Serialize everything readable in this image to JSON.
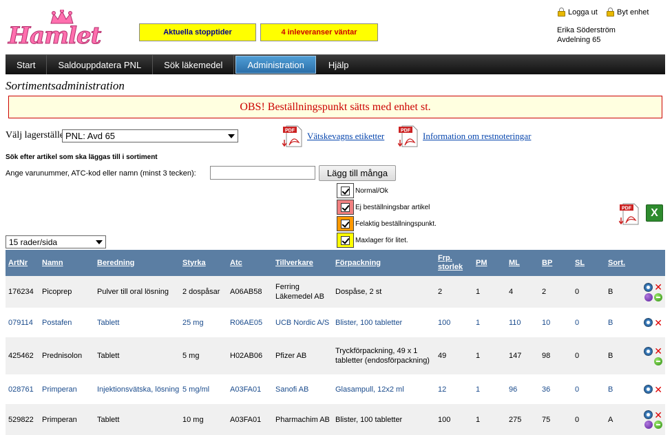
{
  "brand": {
    "logo_text": "Hamlet",
    "logo_color": "#ff6fae"
  },
  "notices": {
    "stopptider": "Aktuella stopptider",
    "inleveranser": "4 inleveranser väntar"
  },
  "top_links": {
    "logout": "Logga ut",
    "switch_unit": "Byt enhet"
  },
  "user": {
    "name": "Erika Söderström",
    "unit": "Avdelning 65"
  },
  "nav": {
    "tabs": [
      "Start",
      "Saldouppdatera PNL",
      "Sök läkemedel",
      "Administration",
      "Hjälp"
    ],
    "active": "Administration"
  },
  "page": {
    "title": "Sortimentsadministration"
  },
  "alert": {
    "text": "OBS! Beställningspunkt sätts med enhet st."
  },
  "stock_select": {
    "label": "Välj lagerställe",
    "value": "PNL: Avd 65"
  },
  "pdf_links": {
    "vatskevagn": "Vätskevagns etiketter",
    "restnoteringar": "Information om restnoteringar",
    "icon_label": "PDF"
  },
  "search": {
    "heading": "Sök efter artikel som ska läggas till i sortiment",
    "label": "Ange varunummer, ATC-kod eller namn (minst 3 tecken):",
    "value": "",
    "button": "Lägg till många"
  },
  "legend": [
    {
      "label": "Normal/Ok",
      "color": "#ffffff"
    },
    {
      "label": "Ej beställningsbar artikel",
      "color": "#f08080"
    },
    {
      "label": "Felaktig beställningspunkt.",
      "color": "#ff9900"
    },
    {
      "label": "Maxlager för litet.",
      "color": "#ffff00"
    }
  ],
  "rows_per_page": {
    "value": "15 rader/sida"
  },
  "excel_icon": "X",
  "table": {
    "columns": [
      "ArtNr",
      "Namn",
      "Beredning",
      "Styrka",
      "Atc",
      "Tillverkare",
      "Förpackning",
      "Frp. storlek",
      "PM",
      "ML",
      "BP",
      "SL",
      "Sort."
    ],
    "rows": [
      {
        "artnr": "176234",
        "namn": "Picoprep",
        "beredning": "Pulver till oral lösning",
        "styrka": "2 dospåsar",
        "atc": "A06AB58",
        "tillverkare": "Ferring Läkemedel AB",
        "forpackning": "Dospåse, 2 st",
        "frp": "2",
        "pm": "1",
        "ml": "4",
        "bp": "2",
        "sl": "0",
        "sort": "B",
        "style": "dark",
        "extra": true
      },
      {
        "artnr": "079114",
        "namn": "Postafen",
        "beredning": "Tablett",
        "styrka": "25 mg",
        "atc": "R06AE05",
        "tillverkare": "UCB Nordic A/S",
        "forpackning": "Blister, 100 tabletter",
        "frp": "100",
        "pm": "1",
        "ml": "110",
        "bp": "10",
        "sl": "0",
        "sort": "B",
        "style": "link",
        "extra": false
      },
      {
        "artnr": "425462",
        "namn": "Prednisolon",
        "beredning": "Tablett",
        "styrka": "5 mg",
        "atc": "H02AB06",
        "tillverkare": "Pfizer AB",
        "forpackning": "Tryckförpackning, 49 x 1 tabletter (endosförpackning)",
        "frp": "49",
        "pm": "1",
        "ml": "147",
        "bp": "98",
        "sl": "0",
        "sort": "B",
        "style": "dark",
        "extra": "green"
      },
      {
        "artnr": "028761",
        "namn": "Primperan",
        "beredning": "Injektionsvätska, lösning",
        "styrka": "5 mg/ml",
        "atc": "A03FA01",
        "tillverkare": "Sanofi AB",
        "forpackning": "Glasampull, 12x2 ml",
        "frp": "12",
        "pm": "1",
        "ml": "96",
        "bp": "36",
        "sl": "0",
        "sort": "B",
        "style": "link",
        "extra": false
      },
      {
        "artnr": "529822",
        "namn": "Primperan",
        "beredning": "Tablett",
        "styrka": "10 mg",
        "atc": "A03FA01",
        "tillverkare": "Pharmachim AB",
        "forpackning": "Blister, 100 tabletter",
        "frp": "100",
        "pm": "1",
        "ml": "275",
        "bp": "75",
        "sl": "0",
        "sort": "A",
        "style": "dark",
        "extra": true
      }
    ]
  }
}
